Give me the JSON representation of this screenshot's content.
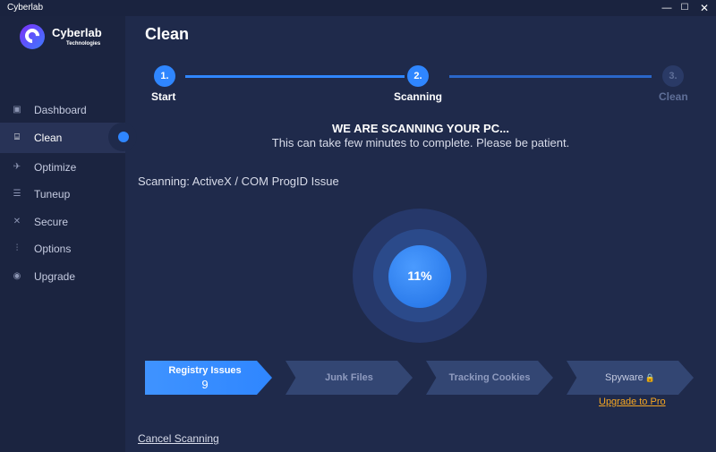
{
  "window": {
    "title": "Cyberlab",
    "minimize": "—",
    "maximize": "☐",
    "close": "✕"
  },
  "brand": {
    "name": "Cyberlab",
    "subtitle": "Technologies"
  },
  "sidebar": {
    "items": [
      {
        "label": "Dashboard",
        "icon": "dashboard-icon",
        "glyph": "▣"
      },
      {
        "label": "Clean",
        "icon": "clean-icon",
        "glyph": "⌸",
        "active": true
      },
      {
        "label": "Optimize",
        "icon": "rocket-icon",
        "glyph": "✈"
      },
      {
        "label": "Tuneup",
        "icon": "tuneup-icon",
        "glyph": "☰"
      },
      {
        "label": "Secure",
        "icon": "tools-icon",
        "glyph": "✕"
      },
      {
        "label": "Options",
        "icon": "sliders-icon",
        "glyph": "⫶"
      },
      {
        "label": "Upgrade",
        "icon": "upgrade-icon",
        "glyph": "◉"
      }
    ]
  },
  "page": {
    "title": "Clean"
  },
  "steps": [
    {
      "number": "1.",
      "label": "Start",
      "state": "done"
    },
    {
      "number": "2.",
      "label": "Scanning",
      "state": "active"
    },
    {
      "number": "3.",
      "label": "Clean",
      "state": "pending"
    }
  ],
  "scan": {
    "headline": "WE ARE SCANNING YOUR PC...",
    "subline": "This can take few minutes to complete. Please be patient.",
    "status": "Scanning: ActiveX / COM ProgID Issue",
    "percent": "11%",
    "progress_fraction": 0.11
  },
  "categories": [
    {
      "name": "Registry Issues",
      "count": "9",
      "state": "active"
    },
    {
      "name": "Junk Files",
      "state": "pending"
    },
    {
      "name": "Tracking Cookies",
      "state": "pending"
    },
    {
      "name": "Spyware",
      "state": "locked",
      "icon": "lock-icon"
    }
  ],
  "links": {
    "upgrade": "Upgrade to Pro",
    "cancel": "Cancel Scanning"
  },
  "colors": {
    "accent": "#2f86ff",
    "background": "#1f2a4b",
    "sidebar": "#1b2440",
    "upgrade_link": "#f5a623"
  }
}
